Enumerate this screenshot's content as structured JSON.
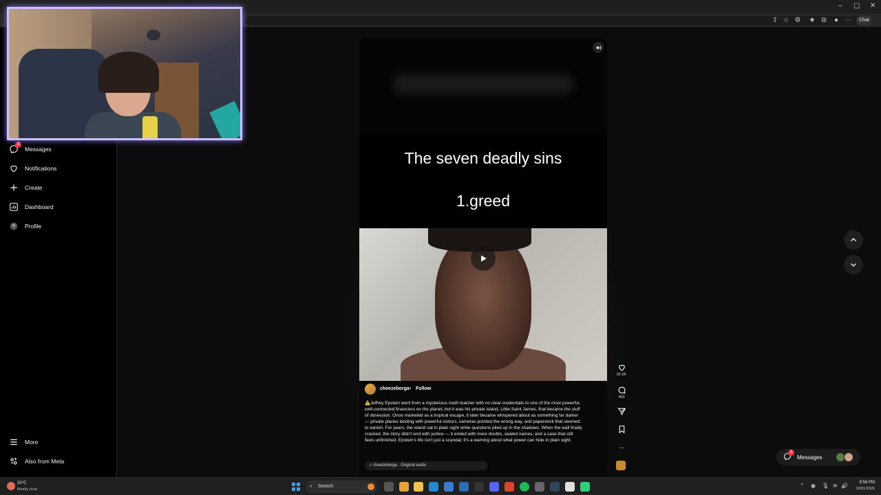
{
  "browser": {
    "chat_label": "Chat",
    "minimize": "–",
    "maximize": "▢",
    "close": "✕"
  },
  "sidebar": {
    "items": [
      {
        "label": "Messages",
        "icon": "messenger-icon",
        "badge": "3"
      },
      {
        "label": "Notifications",
        "icon": "heart-icon"
      },
      {
        "label": "Create",
        "icon": "plus-icon"
      },
      {
        "label": "Dashboard",
        "icon": "dashboard-icon"
      },
      {
        "label": "Profile",
        "icon": "profile-icon"
      }
    ],
    "bottom": [
      {
        "label": "More",
        "icon": "menu-icon"
      },
      {
        "label": "Also from Meta",
        "icon": "meta-icon"
      }
    ]
  },
  "reel": {
    "caption_line1": "The seven deadly sins",
    "caption_line2": "1.greed",
    "username": "cheezeborga",
    "separator": "•",
    "follow_label": "Follow",
    "description": "⚠️Jeffrey Epstein went from a mysterious math teacher with no clear credentials to one of the most powerful, well-connected financiers on the planet, but it was his private island, Little Saint James, that became the stuff of obsession. Once marketed as a tropical escape, it later became whispered about as something far darker — private planes landing with powerful visitors, cameras pointed the wrong way, and paperwork that seemed to vanish. For years, the island sat in plain sight while questions piled up in the shadows. When the wall finally cracked, the story didn't end with justice — it ended with more doubts, sealed names, and a case that still feels unfinished. Epstein's life isn't just a scandal; it's a warning about what power can hide in plain sight.",
    "desc_trailer": ".",
    "audio_label": "cheezeborga · Original audio"
  },
  "actions": {
    "likes": "92.6K",
    "comments": "460",
    "more": "..."
  },
  "messages_pill": {
    "label": "Messages",
    "badge": "3"
  },
  "taskbar": {
    "temperature": "32°C",
    "condition": "Mostly clear",
    "search_placeholder": "Search",
    "time": "9:56 PM",
    "date": "10/01/2026"
  },
  "colors": {
    "accent_red": "#ff3040",
    "webcam_border": "#c9c2ff",
    "taskbar": "#202020"
  }
}
